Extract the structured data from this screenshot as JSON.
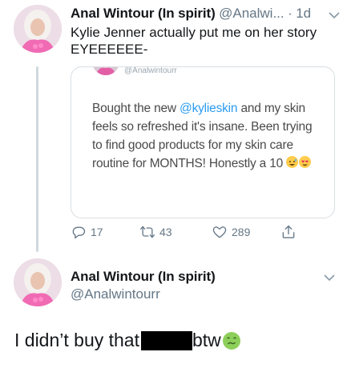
{
  "tweet1": {
    "name": "Anal Wintour (In spirit)",
    "handle": "@Analwi...",
    "separator": "·",
    "time": "1d",
    "text_line1": "Kylie Jenner actually put me on her story",
    "text_line2": "EYEEEEEE-",
    "card": {
      "top_handle": "@Analwintourr",
      "text_before_mention": "Bought the new ",
      "mention": "@kylieskin",
      "text_after_mention": " and my skin feels so refreshed it's insane. Been trying to find good products for my skin care routine for MONTHS! Honestly a 10"
    },
    "actions": {
      "reply_count": "17",
      "retweet_count": "43",
      "like_count": "289"
    }
  },
  "tweet2": {
    "name": "Anal Wintour (In spirit)",
    "handle": "@Analwintourr",
    "text_before_redaction": "I didn’t buy that ",
    "text_after_redaction": "btw"
  },
  "colors": {
    "accent": "#1da1f2",
    "muted": "#657786",
    "thread_line": "#cfd9de"
  },
  "icons": [
    "reply-icon",
    "retweet-icon",
    "like-icon",
    "share-icon",
    "chevron-down-icon"
  ]
}
